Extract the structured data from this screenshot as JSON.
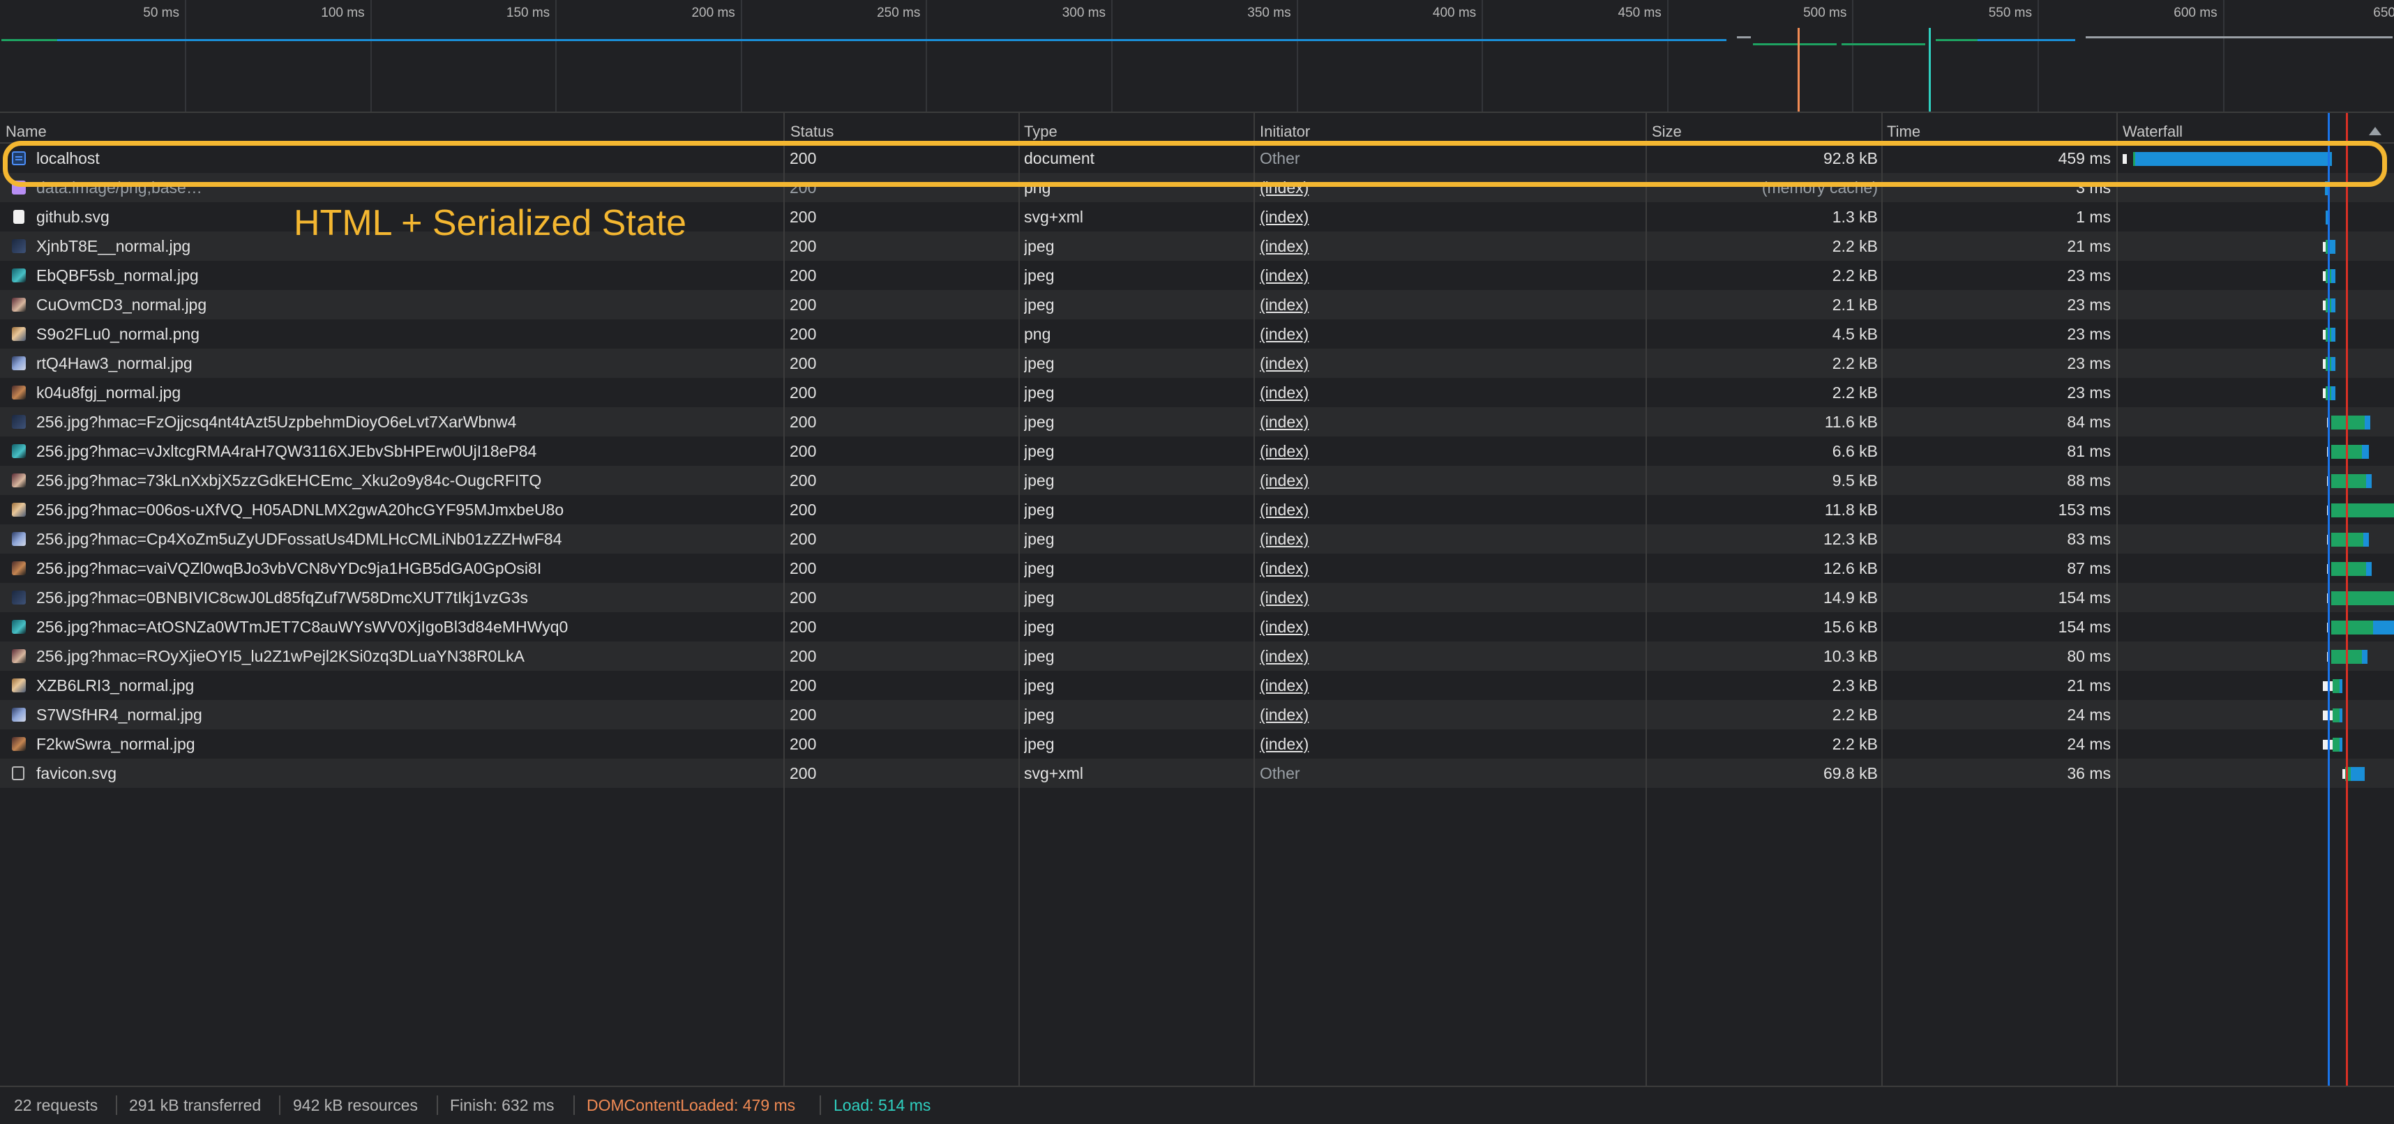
{
  "overview": {
    "ticks": [
      "50 ms",
      "100 ms",
      "150 ms",
      "200 ms",
      "250 ms",
      "300 ms",
      "350 ms",
      "400 ms",
      "450 ms",
      "500 ms",
      "550 ms",
      "600 ms",
      "650"
    ]
  },
  "table": {
    "headers": {
      "name": "Name",
      "status": "Status",
      "type": "Type",
      "initiator": "Initiator",
      "size": "Size",
      "time": "Time",
      "waterfall": "Waterfall"
    },
    "rows": [
      {
        "name": "localhost",
        "status": "200",
        "type": "document",
        "initiator": "Other",
        "size": "92.8 kB",
        "time": "459 ms",
        "icon": "document-icon"
      },
      {
        "name": "data:image/png;base…",
        "status": "200",
        "type": "png",
        "initiator": "(index)",
        "size": "(memory cache)",
        "time": "3 ms",
        "icon": "image-data-icon"
      },
      {
        "name": "github.svg",
        "status": "200",
        "type": "svg+xml",
        "initiator": "(index)",
        "size": "1.3 kB",
        "time": "1 ms",
        "icon": "svg-icon"
      },
      {
        "name": "XjnbT8E__normal.jpg",
        "status": "200",
        "type": "jpeg",
        "initiator": "(index)",
        "size": "2.2 kB",
        "time": "21 ms",
        "icon": "image-thumbnail-icon"
      },
      {
        "name": "EbQBF5sb_normal.jpg",
        "status": "200",
        "type": "jpeg",
        "initiator": "(index)",
        "size": "2.2 kB",
        "time": "23 ms",
        "icon": "image-thumbnail-icon"
      },
      {
        "name": "CuOvmCD3_normal.jpg",
        "status": "200",
        "type": "jpeg",
        "initiator": "(index)",
        "size": "2.1 kB",
        "time": "23 ms",
        "icon": "image-thumbnail-icon"
      },
      {
        "name": "S9o2FLu0_normal.png",
        "status": "200",
        "type": "png",
        "initiator": "(index)",
        "size": "4.5 kB",
        "time": "23 ms",
        "icon": "image-thumbnail-icon"
      },
      {
        "name": "rtQ4Haw3_normal.jpg",
        "status": "200",
        "type": "jpeg",
        "initiator": "(index)",
        "size": "2.2 kB",
        "time": "23 ms",
        "icon": "image-thumbnail-icon"
      },
      {
        "name": "k04u8fgj_normal.jpg",
        "status": "200",
        "type": "jpeg",
        "initiator": "(index)",
        "size": "2.2 kB",
        "time": "23 ms",
        "icon": "image-thumbnail-icon"
      },
      {
        "name": "256.jpg?hmac=FzOjjcsq4nt4tAzt5UzpbehmDioyO6eLvt7XarWbnw4",
        "status": "200",
        "type": "jpeg",
        "initiator": "(index)",
        "size": "11.6 kB",
        "time": "84 ms",
        "icon": "image-thumbnail-icon"
      },
      {
        "name": "256.jpg?hmac=vJxltcgRMA4raH7QW3116XJEbvSbHPErw0UjI18eP84",
        "status": "200",
        "type": "jpeg",
        "initiator": "(index)",
        "size": "6.6 kB",
        "time": "81 ms",
        "icon": "image-thumbnail-icon"
      },
      {
        "name": "256.jpg?hmac=73kLnXxbjX5zzGdkEHCEmc_Xku2o9y84c-OugcRFITQ",
        "status": "200",
        "type": "jpeg",
        "initiator": "(index)",
        "size": "9.5 kB",
        "time": "88 ms",
        "icon": "image-thumbnail-icon"
      },
      {
        "name": "256.jpg?hmac=006os-uXfVQ_H05ADNLMX2gwA20hcGYF95MJmxbeU8o",
        "status": "200",
        "type": "jpeg",
        "initiator": "(index)",
        "size": "11.8 kB",
        "time": "153 ms",
        "icon": "image-thumbnail-icon"
      },
      {
        "name": "256.jpg?hmac=Cp4XoZm5uZyUDFossatUs4DMLHcCMLiNb01zZZHwF84",
        "status": "200",
        "type": "jpeg",
        "initiator": "(index)",
        "size": "12.3 kB",
        "time": "83 ms",
        "icon": "image-thumbnail-icon"
      },
      {
        "name": "256.jpg?hmac=vaiVQZl0wqBJo3vbVCN8vYDc9ja1HGB5dGA0GpOsi8I",
        "status": "200",
        "type": "jpeg",
        "initiator": "(index)",
        "size": "12.6 kB",
        "time": "87 ms",
        "icon": "image-thumbnail-icon"
      },
      {
        "name": "256.jpg?hmac=0BNBIVIC8cwJ0Ld85fqZuf7W58DmcXUT7tIkj1vzG3s",
        "status": "200",
        "type": "jpeg",
        "initiator": "(index)",
        "size": "14.9 kB",
        "time": "154 ms",
        "icon": "image-thumbnail-icon"
      },
      {
        "name": "256.jpg?hmac=AtOSNZa0WTmJET7C8auWYsWV0XjIgoBl3d84eMHWyq0",
        "status": "200",
        "type": "jpeg",
        "initiator": "(index)",
        "size": "15.6 kB",
        "time": "154 ms",
        "icon": "image-thumbnail-icon"
      },
      {
        "name": "256.jpg?hmac=ROyXjieOYI5_lu2Z1wPejl2KSi0zq3DLuaYN38R0LkA",
        "status": "200",
        "type": "jpeg",
        "initiator": "(index)",
        "size": "10.3 kB",
        "time": "80 ms",
        "icon": "image-thumbnail-icon"
      },
      {
        "name": "XZB6LRI3_normal.jpg",
        "status": "200",
        "type": "jpeg",
        "initiator": "(index)",
        "size": "2.3 kB",
        "time": "21 ms",
        "icon": "image-thumbnail-icon"
      },
      {
        "name": "S7WSfHR4_normal.jpg",
        "status": "200",
        "type": "jpeg",
        "initiator": "(index)",
        "size": "2.2 kB",
        "time": "24 ms",
        "icon": "image-thumbnail-icon"
      },
      {
        "name": "F2kwSwra_normal.jpg",
        "status": "200",
        "type": "jpeg",
        "initiator": "(index)",
        "size": "2.2 kB",
        "time": "24 ms",
        "icon": "image-thumbnail-icon"
      },
      {
        "name": "favicon.svg",
        "status": "200",
        "type": "svg+xml",
        "initiator": "Other",
        "size": "69.8 kB",
        "time": "36 ms",
        "icon": "svg-file-icon"
      }
    ]
  },
  "annotation": {
    "text": "HTML + Serialized State"
  },
  "statusbar": {
    "requests": "22 requests",
    "transferred": "291 kB transferred",
    "resources": "942 kB resources",
    "finish": "Finish: 632 ms",
    "dom_content_loaded": "DOMContentLoaded: 479 ms",
    "load": "Load: 514 ms"
  },
  "colors": {
    "dom_content_loaded": "#f28b54",
    "load": "#2fd0c0",
    "highlight": "#f4b731",
    "download_bar": "#1a8fd8",
    "waiting_bar": "#1ea362"
  }
}
